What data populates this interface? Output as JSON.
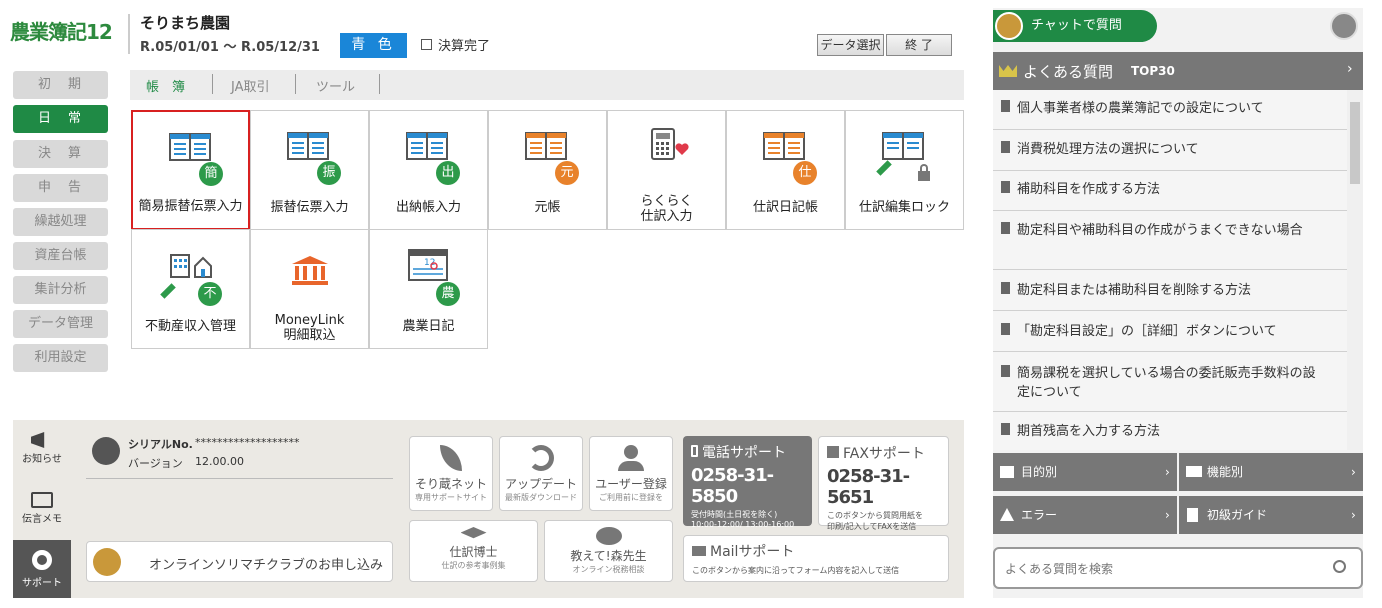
{
  "header": {
    "app_title": "農業簿記12",
    "farm_name": "そりまち農園",
    "period": "R.05/01/01 ～ R.05/12/31",
    "color_label": "青 色",
    "settlement_label": "決算完了",
    "data_select_label": "データ選択",
    "exit_label": "終 了"
  },
  "nav": [
    "初　期",
    "日　常",
    "決　算",
    "申　告",
    "繰越処理",
    "資産台帳",
    "集計分析",
    "データ管理",
    "利用設定"
  ],
  "tabs": [
    "帳　簿",
    "JA取引",
    "ツール"
  ],
  "grid": [
    {
      "label": "簡易振替伝票入力",
      "badge": "簡",
      "badge_color": "#2d9a4a",
      "icon": "ledger-icon"
    },
    {
      "label": "振替伝票入力",
      "badge": "振",
      "badge_color": "#2d9a4a",
      "icon": "ledger-icon"
    },
    {
      "label": "出納帳入力",
      "badge": "出",
      "badge_color": "#2d9a4a",
      "icon": "ledger-icon"
    },
    {
      "label": "元帳",
      "badge": "元",
      "badge_color": "#e8822b",
      "icon": "ledger-icon"
    },
    {
      "label": "らくらく",
      "label2": "仕訳入力",
      "icon": "calculator-icon"
    },
    {
      "label": "仕訳日記帳",
      "badge": "仕",
      "badge_color": "#e8822b",
      "icon": "ledger-icon"
    },
    {
      "label": "仕訳編集ロック",
      "icon": "ledger-lock-icon"
    },
    {
      "label": "不動産収入管理",
      "badge": "不",
      "badge_color": "#2d9a4a",
      "icon": "building-icon"
    },
    {
      "label": "MoneyLink",
      "label2": "明細取込",
      "icon": "bank-icon"
    },
    {
      "label": "農業日記",
      "badge": "農",
      "badge_color": "#2d9a4a",
      "icon": "calendar-icon"
    }
  ],
  "bottom": {
    "side": [
      {
        "label": "お知らせ",
        "icon": "megaphone-icon"
      },
      {
        "label": "伝言メモ",
        "icon": "memo-icon"
      },
      {
        "label": "サポート",
        "icon": "lifebuoy-icon"
      }
    ],
    "serial_label": "シリアルNo.",
    "serial_value": "*******************",
    "version_label": "バージョン",
    "version_value": "12.00.00",
    "club_label": "オンラインソリマチクラブのお申し込み",
    "cards": [
      {
        "title": "そり蔵ネット",
        "sub": "専用サポートサイト",
        "icon": "leaf-icon"
      },
      {
        "title": "アップデート",
        "sub": "最新版ダウンロード",
        "icon": "refresh-icon"
      },
      {
        "title": "ユーザー登録",
        "sub": "ご利用前に登録を",
        "icon": "user-icon"
      },
      {
        "title": "仕訳博士",
        "sub": "仕訳の参考事例集",
        "icon": "graduation-icon"
      },
      {
        "title": "教えて!森先生",
        "sub": "オンライン税務相談",
        "icon": "chat-icon"
      }
    ],
    "phone": {
      "title": "電話サポート",
      "number": "0258-31-5850",
      "hours1": "受付時間(土日祝を除く)",
      "hours2": "10:00-12:00/ 13:00-16:00"
    },
    "fax": {
      "title": "FAXサポート",
      "number": "0258-31-5651",
      "desc1": "このボタンから質問用紙を",
      "desc2": "印刷/記入してFAXを送信"
    },
    "mail": {
      "title": "Mailサポート",
      "desc": "このボタンから案内に沿ってフォーム内容を記入して送信"
    }
  },
  "right": {
    "chat_label": "チャットで質問",
    "faq_title": "よくある質問",
    "faq_top": "TOP30",
    "faq": [
      "個人事業者様の農業簿記での設定について",
      "消費税処理方法の選択について",
      "補助科目を作成する方法",
      "勘定科目や補助科目の作成がうまくできない場合",
      "勘定科目または補助科目を削除する方法",
      "「勘定科目設定」の［詳細］ボタンについて",
      "簡易課税を選択している場合の委託販売手数料の設定について",
      "期首残高を入力する方法"
    ],
    "categories": [
      "目的別",
      "機能別",
      "エラー",
      "初級ガイド"
    ],
    "search_placeholder": "よくある質問を検索"
  },
  "colors": {
    "green": "#1f8a45",
    "blue": "#1a86d8",
    "red_select": "#d82020"
  }
}
